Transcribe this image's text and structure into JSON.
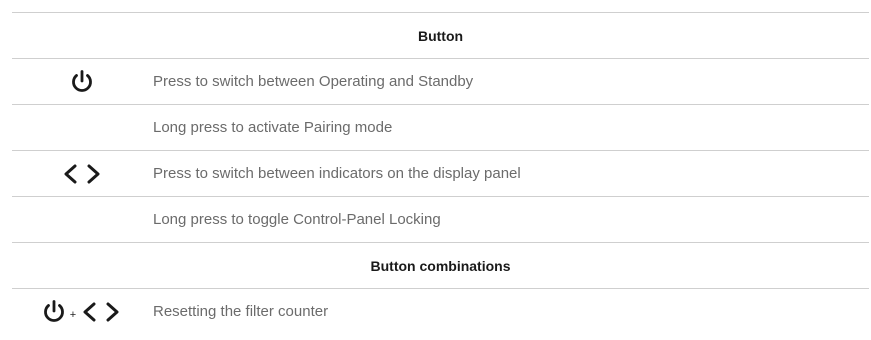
{
  "sections": {
    "button": {
      "header": "Button",
      "rows": [
        {
          "icon": "power-icon",
          "text": "Press to switch between Operating and Standby"
        },
        {
          "icon": "",
          "text": "Long press to activate Pairing mode"
        },
        {
          "icon": "left-right-chevrons-icon",
          "text": "Press to switch between indicators on the display panel"
        },
        {
          "icon": "",
          "text": "Long press to toggle Control-Panel Locking"
        }
      ]
    },
    "combinations": {
      "header": "Button combinations",
      "rows": [
        {
          "icon": "power-plus-chevrons-icon",
          "plus": "+",
          "text": "Resetting the filter counter"
        }
      ]
    }
  },
  "colors": {
    "text": "#6b6b6b",
    "header": "#1a1a1a",
    "rule": "#cfcfcf",
    "icon": "#1a1a1a"
  }
}
